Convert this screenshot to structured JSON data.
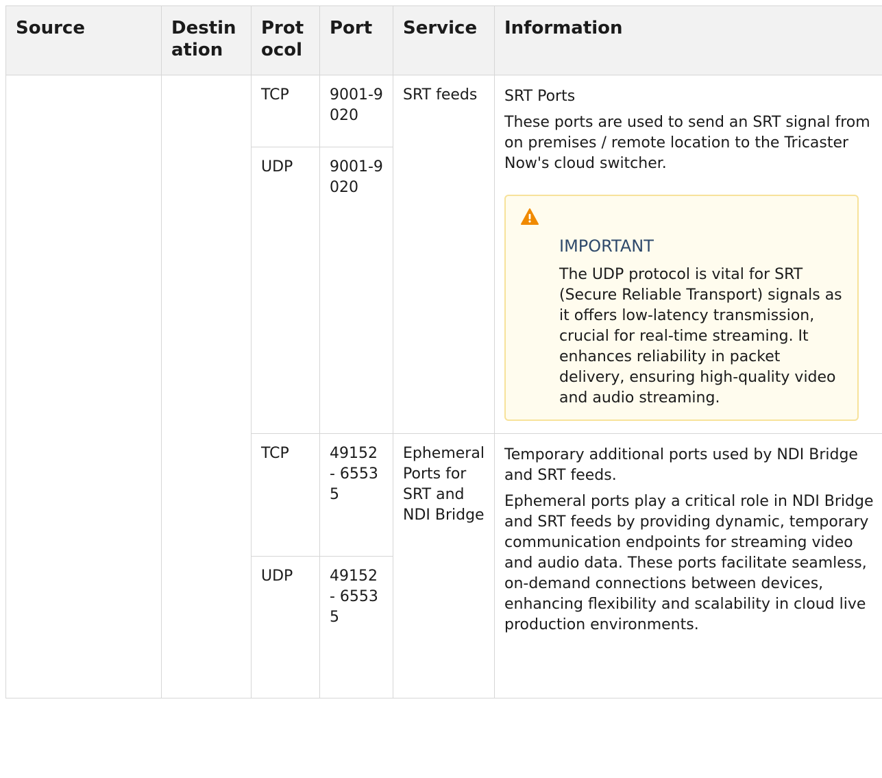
{
  "table": {
    "headers": [
      "Source",
      "Destination",
      "Protocol",
      "Port",
      "Service",
      "Information"
    ],
    "rows": [
      {
        "protocol": "TCP",
        "port": "9001-9020"
      },
      {
        "protocol": "UDP",
        "port": "9001-9020"
      },
      {
        "protocol": "TCP",
        "port": "49152 - 65535"
      },
      {
        "protocol": "UDP",
        "port": "49152 - 65535"
      }
    ],
    "groups": [
      {
        "service": "SRT feeds",
        "info_title": "SRT Ports",
        "info_text": "These ports are used to send an SRT signal from on premises / remote location to the Tricaster Now's cloud switcher.",
        "callout": {
          "icon": "warning-icon",
          "title": "IMPORTANT",
          "text": "The UDP protocol is vital for SRT (Secure Reliable Transport) signals as it offers low-latency transmission, crucial for real-time streaming. It enhances reliability in packet delivery, ensuring high-quality video and audio streaming."
        }
      },
      {
        "service": "Ephemeral Ports for SRT and NDI Bridge",
        "info_title": "Temporary additional ports used by NDI Bridge and SRT feeds.",
        "info_text": "Ephemeral ports play a critical role in NDI Bridge and SRT feeds by providing dynamic, temporary communication endpoints for streaming video and audio data. These ports facilitate seamless, on-demand connections between devices, enhancing flexibility and scalability in cloud live production environments."
      }
    ]
  },
  "colors": {
    "header_bg": "#f2f2f2",
    "border": "#d6d6d6",
    "callout_bg": "#fffcee",
    "callout_border": "#f7e29a",
    "warning_icon": "#f08a00",
    "callout_title": "#2f4a6b"
  }
}
